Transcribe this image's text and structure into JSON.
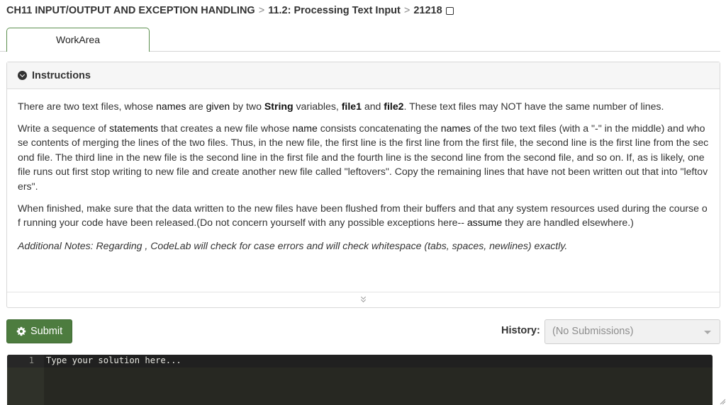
{
  "breadcrumb": {
    "chapter": "CH11 INPUT/OUTPUT AND EXCEPTION HANDLING",
    "separator": ">",
    "section": "11.2: Processing Text Input",
    "exercise": "21218"
  },
  "tabs": [
    {
      "label": "WorkArea",
      "active": true
    }
  ],
  "instructions": {
    "header": "Instructions",
    "p1": {
      "t1": "There are two text files, whose ",
      "k1": "names",
      "t2": " are ",
      "k2": "given",
      "t3": " by two ",
      "b1": "String",
      "t4": " variables, ",
      "b2": "file1",
      "t5": " and ",
      "b3": "file2",
      "t6": ". These text files may NOT have the same number of lines."
    },
    "p2": {
      "t1": "Write a sequence of ",
      "k1": "statements",
      "t2": " that creates a new file whose ",
      "k2": "name",
      "t3": " consists concatenating the ",
      "k3": "names",
      "t4": " of the two text files (with a \"-\" in the middle) and whose contents of merging the lines of the two files. Thus, in the new file, the first line is the first line from the first file, the second line is the first line from the second file. The third line in the new file is the second line in the first file and the fourth line is the second line from the second file, and so on. If, as is likely, one file runs out first stop writing to new file and create another new file called \"leftovers\". Copy the remaining lines that have not been written out that into \"leftovers\"."
    },
    "p3": {
      "t1": "When finished, make sure that the data written to the new files have been flushed from their buffers and that any system resources used during the course of running your code have been released.(Do not concern yourself with any possible exceptions here-- ",
      "k1": "assume",
      "t2": " they are handled elsewhere.)"
    },
    "note": "Additional Notes: Regarding , CodeLab will check for case errors and will check whitespace (tabs, spaces, newlines) exactly."
  },
  "actions": {
    "submit_label": "Submit",
    "history_label": "History:",
    "history_value": "(No Submissions)"
  },
  "editor": {
    "line_number": "1",
    "placeholder": "Type your solution here..."
  },
  "colors": {
    "accent_green": "#4d7c3f",
    "tab_border": "#5b8f4e",
    "editor_bg": "#272822"
  }
}
